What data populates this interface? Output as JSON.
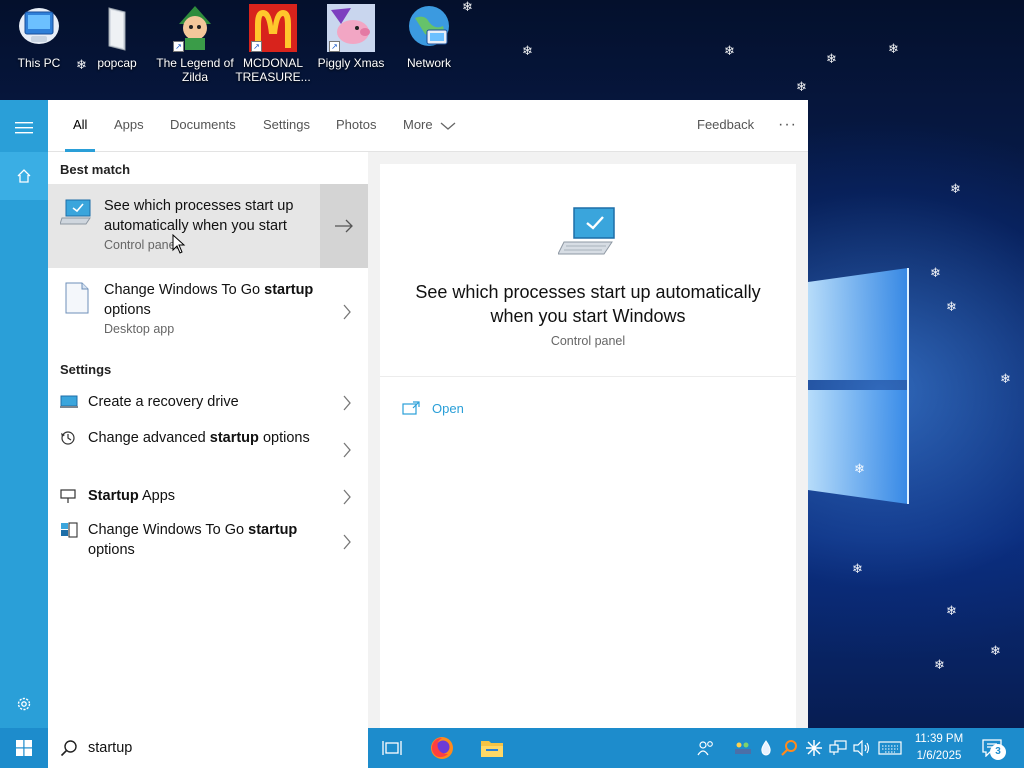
{
  "desktop": {
    "icons": [
      {
        "label": "This PC"
      },
      {
        "label": "popcap"
      },
      {
        "label": "The Legend of Zilda"
      },
      {
        "label": "MCDONAL TREASURE..."
      },
      {
        "label": "Piggly Xmas"
      },
      {
        "label": "Network"
      }
    ]
  },
  "tabs": {
    "all": "All",
    "apps": "Apps",
    "documents": "Documents",
    "settings": "Settings",
    "photos": "Photos",
    "more": "More",
    "feedback": "Feedback",
    "options": "···"
  },
  "results": {
    "best_match_label": "Best match",
    "best_match": {
      "title": "See which processes start up automatically when you start",
      "subtitle": "Control panel"
    },
    "second": {
      "title_pre": "Change Windows To Go",
      "title_bold": "startup",
      "title_post": "options",
      "subtitle": "Desktop app"
    },
    "settings_label": "Settings",
    "settings_items": [
      {
        "pre": "Create a recovery drive",
        "bold": "",
        "post": ""
      },
      {
        "pre": "Change advanced",
        "bold": "startup",
        "post": "options"
      },
      {
        "pre": "",
        "bold": "Startup",
        "post": "Apps"
      },
      {
        "pre": "Change Windows To Go",
        "bold": "startup",
        "post": "options"
      }
    ]
  },
  "preview": {
    "title": "See which processes start up automatically when you start Windows",
    "subtitle": "Control panel",
    "open_label": "Open"
  },
  "taskbar": {
    "search_value": "startup",
    "time": "11:39 PM",
    "date": "1/6/2025",
    "notification_count": "3"
  },
  "colors": {
    "accent": "#2a9fd8",
    "taskbar": "#1d8ccc"
  }
}
